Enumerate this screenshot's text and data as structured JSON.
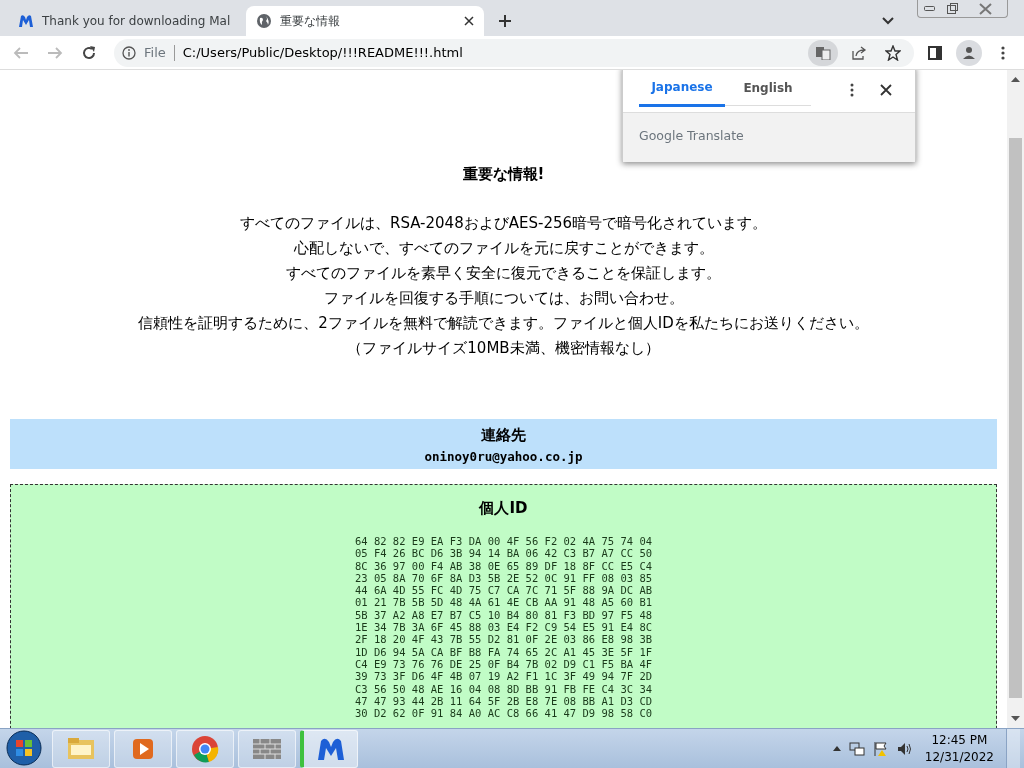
{
  "browser": {
    "tabs": [
      {
        "title": "Thank you for downloading Mal",
        "kind": "logo",
        "selected": false
      },
      {
        "title": "重要な情報",
        "kind": "globe",
        "selected": true
      }
    ],
    "address": {
      "scheme": "File",
      "url": "C:/Users/Public/Desktop/!!!README!!!.html"
    },
    "translate_popup": {
      "tabs": [
        {
          "label": "Japanese",
          "selected": true
        },
        {
          "label": "English",
          "selected": false
        }
      ],
      "footer": "Google Translate"
    }
  },
  "page": {
    "heading": "重要な情報!",
    "lines": [
      "すべてのファイルは、RSA-2048およびAES-256暗号で暗号化されています。",
      "心配しないで、すべてのファイルを元に戻すことができます。",
      "すべてのファイルを素早く安全に復元できることを保証します。",
      "ファイルを回復する手順については、お問い合わせ。",
      "信頼性を証明するために、2ファイルを無料で解読できます。ファイルと個人IDを私たちにお送りください。",
      "（ファイルサイズ10MB未満、機密情報なし）"
    ],
    "contact": {
      "heading": "連絡先",
      "email": "oninoy0ru@yahoo.co.jp"
    },
    "personal_id": {
      "heading": "個人ID",
      "lines": [
        "64 82 82 E9 EA F3 DA 00 4F 56 F2 02 4A 75 74 04",
        "05 F4 26 BC D6 3B 94 14 BA 06 42 C3 B7 A7 CC 50",
        "8C 36 97 00 F4 AB 38 0E 65 89 DF 18 8F CC E5 C4",
        "23 05 8A 70 6F 8A D3 5B 2E 52 0C 91 FF 08 03 85",
        "44 6A 4D 55 FC 4D 75 C7 CA 7C 71 5F 88 9A DC AB",
        "01 21 7B 5B 5D 48 4A 61 4E CB AA 91 48 A5 60 B1",
        "5B 37 A2 A8 E7 B7 C5 10 B4 80 81 F3 BD 97 F5 48",
        "1E 34 7B 3A 6F 45 88 03 E4 F2 C9 54 E5 91 E4 8C",
        "2F 18 20 4F 43 7B 55 D2 81 0F 2E 03 86 E8 98 3B",
        "1D D6 94 5A CA BF B8 FA 74 65 2C A1 45 3E 5F 1F",
        "C4 E9 73 76 76 DE 25 0F B4 7B 02 D9 C1 F5 BA 4F",
        "39 73 3F D6 4F 4B 07 19 A2 F1 1C 3F 49 94 7F 2D",
        "C3 56 50 48 AE 16 04 08 8D BB 91 FB FE C4 3C 34",
        "47 47 93 44 2B 11 64 5F 2B E8 7E 08 BB A1 D3 CD",
        "30 D2 62 0F 91 84 A0 AC C8 66 41 47 D9 98 58 C0"
      ]
    }
  },
  "taskbar": {
    "apps": [
      {
        "kind": "folder",
        "selected": false
      },
      {
        "kind": "media",
        "selected": false
      },
      {
        "kind": "browser",
        "selected": false
      },
      {
        "kind": "wall",
        "selected": false
      },
      {
        "kind": "logo",
        "selected": true
      }
    ],
    "time": "12:45 PM",
    "date": "12/31/2022"
  }
}
